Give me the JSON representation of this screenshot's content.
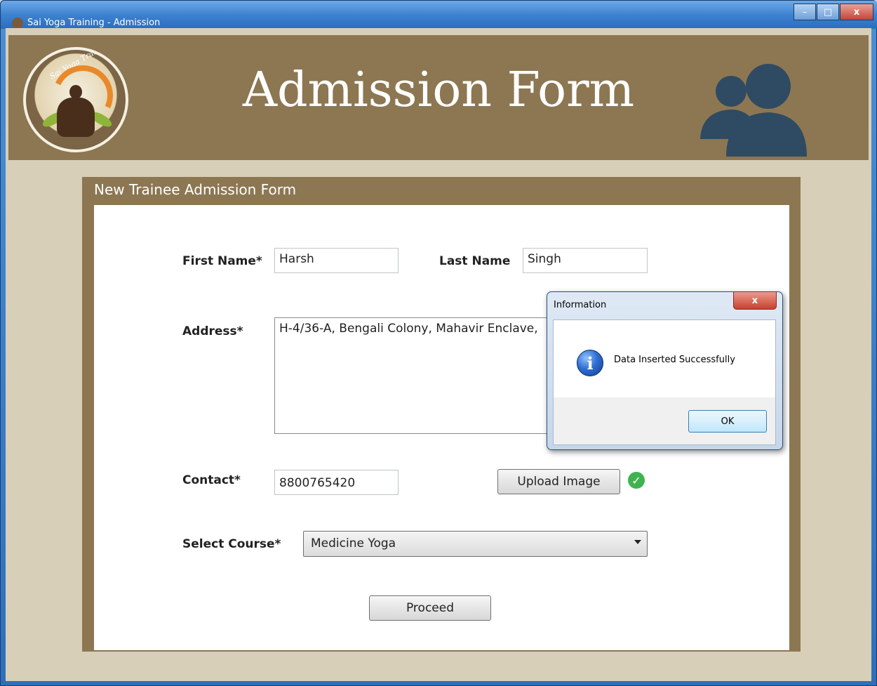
{
  "window": {
    "title": "Sai Yoga Training - Admission",
    "minimize_label": "–",
    "maximize_label": "□",
    "close_label": "x"
  },
  "header": {
    "title": "Admission Form",
    "logo_text": "Sai Yoga Training"
  },
  "form": {
    "panel_title": "New Trainee Admission Form",
    "first_name": {
      "label": "First Name*",
      "value": "Harsh"
    },
    "last_name": {
      "label": "Last Name",
      "value": "Singh"
    },
    "address": {
      "label": "Address*",
      "value": "H-4/36-A, Bengali Colony, Mahavir Enclave,"
    },
    "contact": {
      "label": "Contact*",
      "value": "8800765420"
    },
    "upload_button": "Upload Image",
    "upload_status_icon": "check-circle-icon",
    "course": {
      "label": "Select Course*",
      "selected": "Medicine Yoga"
    },
    "proceed_button": "Proceed"
  },
  "dialog": {
    "title": "Information",
    "close_label": "x",
    "message": "Data Inserted Successfully",
    "icon": "info-icon",
    "ok_label": "OK"
  },
  "colors": {
    "header_bg": "#8c7752",
    "client_bg": "#d8cfb8",
    "success_green": "#3fb34f",
    "users_icon": "#2f4a63"
  }
}
